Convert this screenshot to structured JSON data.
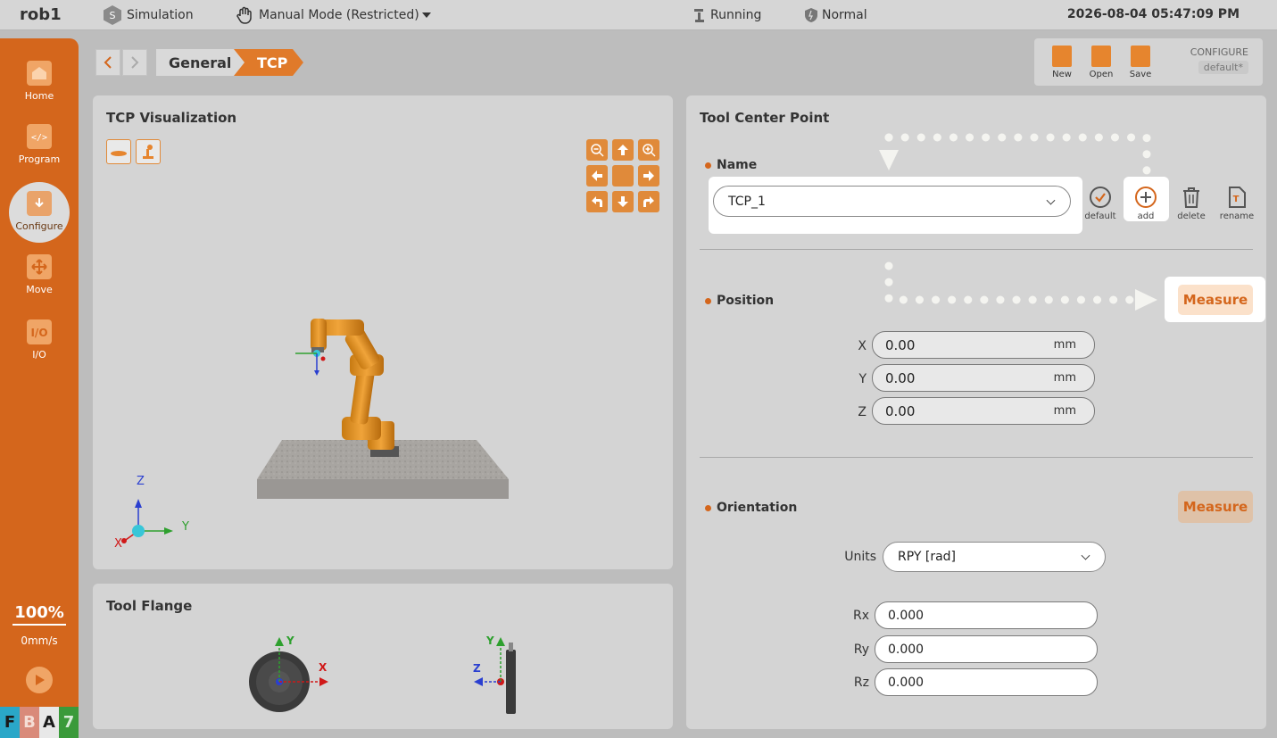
{
  "topbar": {
    "robot": "rob1",
    "mode": "Simulation",
    "manual_mode": "Manual Mode (Restricted)",
    "run_state": "Running",
    "safety": "Normal",
    "datetime": "2026-08-04 05:47:09 PM"
  },
  "sidebar": {
    "items": [
      {
        "label": "Home",
        "icon": "home-icon"
      },
      {
        "label": "Program",
        "icon": "code-icon"
      },
      {
        "label": "Configure",
        "icon": "configure-icon"
      },
      {
        "label": "Move",
        "icon": "move-icon"
      },
      {
        "label": "I/O",
        "icon": "io-icon"
      }
    ],
    "active": "Configure",
    "speed_percent": "100%",
    "speed_mms": "0mm/s",
    "fba": [
      "F",
      "B",
      "A",
      "7"
    ],
    "fba_colors": [
      "#2aa7c8",
      "#d98a7a",
      "#e8e8e8",
      "#3a9a3a"
    ]
  },
  "breadcrumb": {
    "items": [
      "General",
      "TCP"
    ]
  },
  "filebar": {
    "new_label": "New",
    "open_label": "Open",
    "save_label": "Save",
    "configure_label": "CONFIGURE",
    "configure_value": "default*"
  },
  "viz": {
    "title": "TCP Visualization",
    "axes": {
      "z": "Z",
      "y": "Y",
      "x": "X"
    }
  },
  "flange": {
    "title": "Tool Flange",
    "front_axes": {
      "y": "Y",
      "x": "X"
    },
    "side_axes": {
      "y": "Y",
      "z": "Z"
    }
  },
  "tcp": {
    "title": "Tool Center Point",
    "name_label": "Name",
    "name_value": "TCP_1",
    "actions": {
      "default": "default",
      "add": "add",
      "delete": "delete",
      "rename": "rename"
    },
    "position_label": "Position",
    "measure_label": "Measure",
    "position": [
      {
        "axis": "X",
        "value": "0.00",
        "unit": "mm"
      },
      {
        "axis": "Y",
        "value": "0.00",
        "unit": "mm"
      },
      {
        "axis": "Z",
        "value": "0.00",
        "unit": "mm"
      }
    ],
    "orientation_label": "Orientation",
    "orientation_measure_label": "Measure",
    "units_label": "Units",
    "units_value": "RPY [rad]",
    "orientation": [
      {
        "axis": "Rx",
        "value": "0.000"
      },
      {
        "axis": "Ry",
        "value": "0.000"
      },
      {
        "axis": "Rz",
        "value": "0.000"
      }
    ]
  },
  "colors": {
    "accent": "#d4661c",
    "sidebar": "#d4661c"
  }
}
